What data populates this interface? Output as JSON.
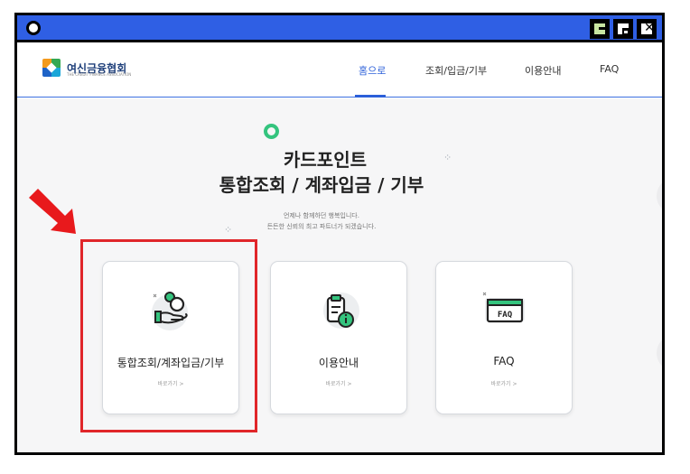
{
  "window": {
    "buttons": [
      "minimize",
      "maximize",
      "close"
    ],
    "close_glyph": "✕"
  },
  "logo": {
    "name": "여신금융협회",
    "tagline": "THE CREDIT FINANCE ASSOCIATION"
  },
  "nav": {
    "home": "홈으로",
    "inquiry": "조회/입금/기부",
    "guide": "이용안내",
    "faq": "FAQ"
  },
  "hero": {
    "title_line1": "카드포인트",
    "title_line2": "통합조회 / 계좌입금 / 기부",
    "sub_line1": "언제나 함께하던 행복입니다.",
    "sub_line2": "든든한 신뢰의 최고 파트너가 되겠습니다."
  },
  "cards": [
    {
      "label": "통합조회/계좌입금/기부",
      "link": "바로가기 >",
      "icon": "hand-coin-icon"
    },
    {
      "label": "이용안내",
      "link": "바로가기 >",
      "icon": "clipboard-info-icon"
    },
    {
      "label": "FAQ",
      "link": "바로가기 >",
      "icon": "faq-window-icon"
    }
  ],
  "colors": {
    "titlebar": "#2f5fe4",
    "accent": "#2b5fd9",
    "green": "#34c47e",
    "highlight": "#e0262a"
  }
}
